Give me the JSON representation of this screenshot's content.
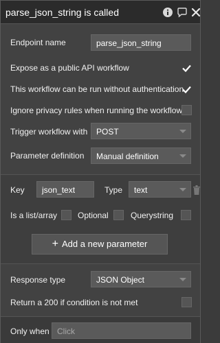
{
  "header": {
    "title": "parse_json_string is called"
  },
  "settings": {
    "endpoint_name_label": "Endpoint name",
    "endpoint_name_value": "parse_json_string",
    "expose_label": "Expose as a public API workflow",
    "expose_checked": true,
    "noauth_label": "This workflow can be run without authentication",
    "noauth_checked": true,
    "ignore_privacy_label": "Ignore privacy rules when running the workflow",
    "ignore_privacy_checked": false,
    "trigger_label": "Trigger workflow with",
    "trigger_value": "POST",
    "param_def_label": "Parameter definition",
    "param_def_value": "Manual definition"
  },
  "parameter": {
    "key_label": "Key",
    "key_value": "json_text",
    "type_label": "Type",
    "type_value": "text",
    "list_label": "Is a list/array",
    "optional_label": "Optional",
    "querystring_label": "Querystring",
    "add_button_label": "Add a new parameter"
  },
  "response": {
    "type_label": "Response type",
    "type_value": "JSON Object",
    "return200_label": "Return a 200 if condition is not met"
  },
  "condition": {
    "only_when_label": "Only when",
    "only_when_placeholder": "Click"
  },
  "icons": {
    "info": "info-icon",
    "comment": "comment-icon",
    "close": "close-icon",
    "trash": "trash-icon",
    "check": "check-icon",
    "plus": "plus-icon",
    "caret": "chevron-down-icon"
  },
  "colors": {
    "panel_bg": "#424242",
    "titlebar_bg": "#2b2b2b",
    "field_bg": "#5a5a5a"
  }
}
